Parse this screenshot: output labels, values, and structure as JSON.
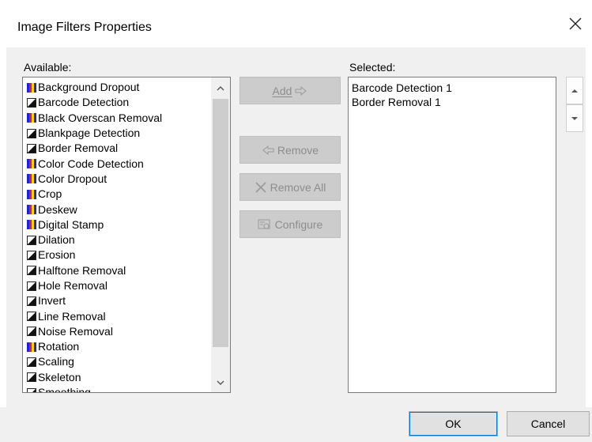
{
  "window": {
    "title": "Image Filters Properties",
    "close_glyph": "✕"
  },
  "available": {
    "label": "Available:",
    "items": [
      {
        "label": "Background Dropout",
        "icon": "color-filter-icon"
      },
      {
        "label": "Barcode Detection",
        "icon": "bw-filter-icon"
      },
      {
        "label": "Black Overscan Removal",
        "icon": "color-filter-icon"
      },
      {
        "label": "Blankpage Detection",
        "icon": "bw-filter-icon"
      },
      {
        "label": "Border Removal",
        "icon": "bw-filter-icon"
      },
      {
        "label": "Color Code Detection",
        "icon": "color-filter-icon"
      },
      {
        "label": "Color Dropout",
        "icon": "color-filter-icon"
      },
      {
        "label": "Crop",
        "icon": "color-filter-icon"
      },
      {
        "label": "Deskew",
        "icon": "color-filter-icon"
      },
      {
        "label": "Digital Stamp",
        "icon": "color-filter-icon"
      },
      {
        "label": "Dilation",
        "icon": "bw-filter-icon"
      },
      {
        "label": "Erosion",
        "icon": "bw-filter-icon"
      },
      {
        "label": "Halftone Removal",
        "icon": "bw-filter-icon"
      },
      {
        "label": "Hole Removal",
        "icon": "bw-filter-icon"
      },
      {
        "label": "Invert",
        "icon": "bw-filter-icon"
      },
      {
        "label": "Line Removal",
        "icon": "bw-filter-icon"
      },
      {
        "label": "Noise Removal",
        "icon": "bw-filter-icon"
      },
      {
        "label": "Rotation",
        "icon": "color-filter-icon"
      },
      {
        "label": "Scaling",
        "icon": "bw-filter-icon"
      },
      {
        "label": "Skeleton",
        "icon": "bw-filter-icon"
      },
      {
        "label": "Smoothing",
        "icon": "bw-filter-icon"
      }
    ]
  },
  "selected": {
    "label": "Selected:",
    "items": [
      "Barcode Detection 1",
      "Border Removal 1"
    ]
  },
  "buttons": {
    "add": "Add",
    "remove": "Remove",
    "remove_all": "Remove All",
    "configure": "Configure",
    "ok": "OK",
    "cancel": "Cancel"
  }
}
